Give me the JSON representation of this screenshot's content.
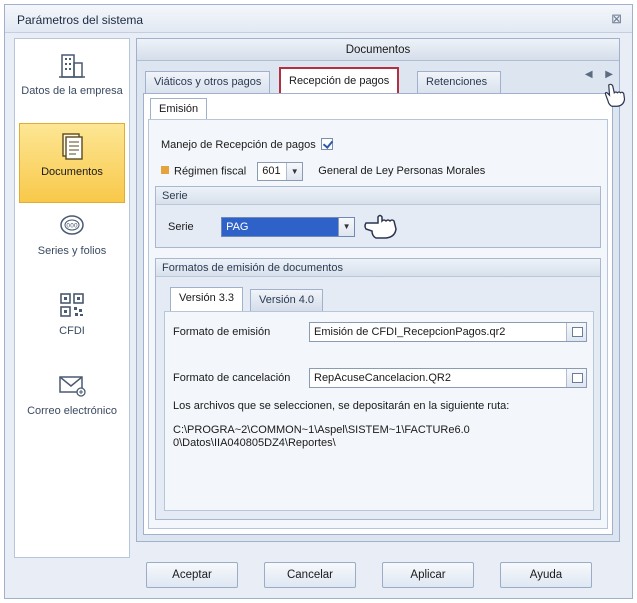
{
  "window": {
    "title": "Parámetros del sistema",
    "close_glyph": "⊠"
  },
  "sidebar": {
    "items": [
      {
        "label": "Datos de la empresa",
        "icon": "building-icon",
        "active": false
      },
      {
        "label": "Documentos",
        "icon": "document-icon",
        "active": true
      },
      {
        "label": "Series y folios",
        "icon": "series-icon",
        "active": false
      },
      {
        "label": "CFDI",
        "icon": "qr-code-icon",
        "active": false
      },
      {
        "label": "Correo electrónico",
        "icon": "envelope-icon",
        "active": false
      }
    ]
  },
  "main": {
    "header": "Documentos",
    "tabs": [
      {
        "label": "Viáticos y otros pagos",
        "active": false
      },
      {
        "label": "Recepción de pagos",
        "active": true
      },
      {
        "label": "Retenciones",
        "active": false
      }
    ],
    "subtab": "Emisión",
    "manejo_label": "Manejo de Recepción de pagos",
    "regimen_label": "Régimen fiscal",
    "regimen_value": "601",
    "regimen_desc": "General de Ley Personas Morales",
    "serie_group": {
      "title": "Serie",
      "label": "Serie",
      "value": "PAG"
    },
    "formatos_group": {
      "title": "Formatos de emisión de documentos",
      "version_tabs": [
        "Versión 3.3",
        "Versión 4.0"
      ],
      "emision_label": "Formato de emisión",
      "emision_value": "Emisión de CFDI_RecepcionPagos.qr2",
      "cancelacion_label": "Formato de cancelación",
      "cancelacion_value": "RepAcuseCancelacion.QR2",
      "ruta_label": "Los archivos que se seleccionen, se depositarán en la siguiente ruta:",
      "ruta_value": "C:\\PROGRA~2\\COMMON~1\\Aspel\\SISTEM~1\\FACTURe6.00\\Datos\\IIA040805DZ4\\Reportes\\"
    }
  },
  "footer": {
    "buttons": [
      "Aceptar",
      "Cancelar",
      "Aplicar",
      "Ayuda"
    ]
  }
}
